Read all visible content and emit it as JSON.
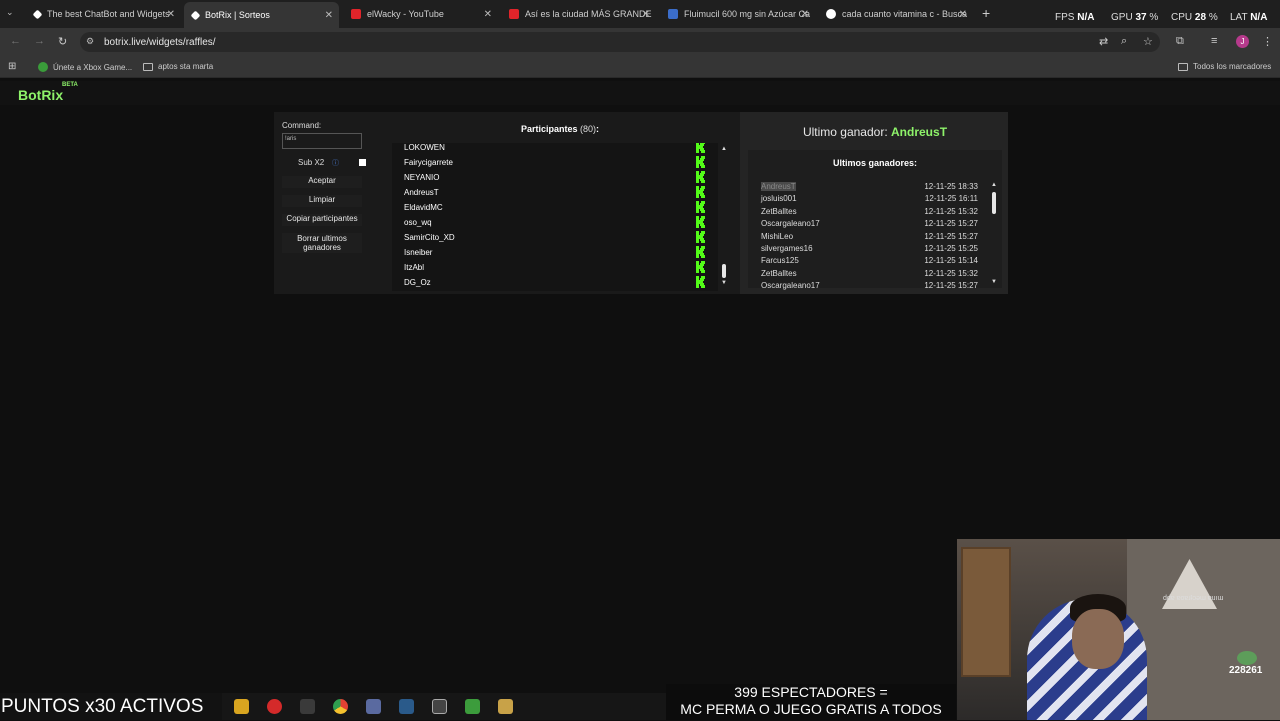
{
  "browser": {
    "tabs": [
      {
        "title": "The best ChatBot and Widgets",
        "fav_color": "#ffffff"
      },
      {
        "title": "BotRix | Sorteos",
        "fav_color": "#ffffff"
      },
      {
        "title": "elWacky - YouTube",
        "fav_color": "#e0242a"
      },
      {
        "title": "Así es la ciudad MÁS GRANDE",
        "fav_color": "#e0242a"
      },
      {
        "title": "Fluimucil 600 mg sin Azúcar Ca",
        "fav_color": "#3b6dc9"
      },
      {
        "title": "cada cuanto vitamina c - Busca",
        "fav_color": "#4a8cf0"
      }
    ],
    "new_tab": "+",
    "stats": {
      "fps_label": "FPS",
      "fps_value": "N/A",
      "gpu_label": "GPU",
      "gpu_value": "37",
      "cpu_label": "CPU",
      "cpu_value": "28",
      "lat_label": "LAT",
      "lat_value": "N/A",
      "percent": "%"
    },
    "url": "botrix.live/widgets/raffles/",
    "bookmarks": [
      {
        "label": "Únete a Xbox Game..."
      },
      {
        "label": "aptos sta marta"
      }
    ],
    "all_bookmarks": "Todos los marcadores",
    "profile_initial": "J"
  },
  "app": {
    "logo": "BotRix",
    "beta": "BETA"
  },
  "controls": {
    "command_label": "Command:",
    "command_value": "!aris",
    "sub_label": "Sub X2",
    "accept": "Aceptar",
    "clear": "Limpiar",
    "copy_participants": "Copiar participantes",
    "delete_winners": "Borrar ultimos ganadores"
  },
  "participants": {
    "title": "Participantes",
    "count": "(80)",
    "colon": ":",
    "list": [
      "LOKOWEN",
      "Fairycigarrete",
      "NEYANIO",
      "AndreusT",
      "EldavidMC",
      "oso_wq",
      "SamirCito_XD",
      "Isneiber",
      "ItzAbl",
      "DG_Oz"
    ]
  },
  "winner": {
    "label": "Ultimo ganador:",
    "name": "AndreusT",
    "history_title": "Ultimos ganadores:",
    "history": [
      {
        "name": "AndreusT",
        "date": "12-11-25 18:33"
      },
      {
        "name": "josluis001",
        "date": "12-11-25 16:11"
      },
      {
        "name": "ZetBalltes",
        "date": "12-11-25 15:32"
      },
      {
        "name": "Oscargaleano17",
        "date": "12-11-25 15:27"
      },
      {
        "name": "MishiLeo",
        "date": "12-11-25 15:27"
      },
      {
        "name": "silvergames16",
        "date": "12-11-25 15:25"
      },
      {
        "name": "Farcus125",
        "date": "12-11-25 15:14"
      },
      {
        "name": "ZetBalltes",
        "date": "12-11-25 15:32"
      },
      {
        "name": "Oscargaleano17",
        "date": "12-11-25 15:27"
      }
    ]
  },
  "stream_overlay": {
    "left_text": "PUNTOS x30 ACTIVOS",
    "bottom_line1": "399 ESPECTADORES =",
    "bottom_line2": "MC PERMA O JUEGO GRATIS A TODOS",
    "cam_text": "ddɐ ɐoɐɹʇɔǝɯ ɐuıɯ",
    "cam_badge": "228261"
  },
  "colors": {
    "accent": "#8ef36a",
    "kick_green": "#53fc18"
  }
}
